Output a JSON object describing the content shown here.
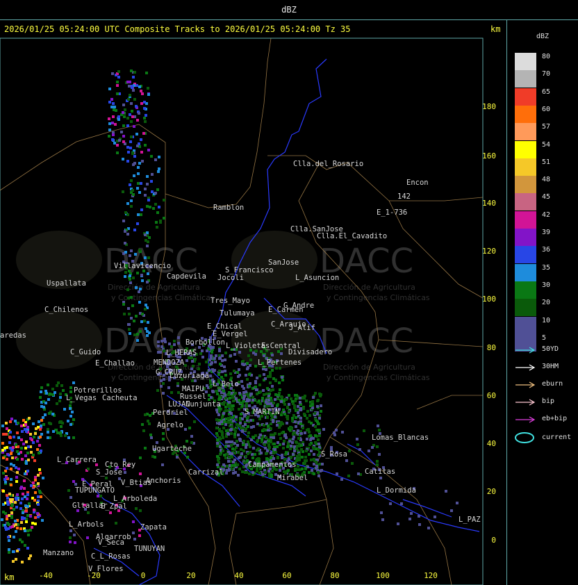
{
  "window": {
    "title": "dBZ"
  },
  "header": {
    "text": "2026/01/25 05:24:00 UTC Composite Tracks to 2026/01/25 05:24:00 Tz 35",
    "km_top": "km",
    "km_bottom": "km"
  },
  "axes": {
    "y_ticks": [
      "180",
      "160",
      "140",
      "120",
      "100",
      "80",
      "60",
      "40",
      "20",
      "0"
    ],
    "x_ticks": [
      "-40",
      "-20",
      "0",
      "20",
      "40",
      "60",
      "80",
      "100",
      "120"
    ]
  },
  "places": [
    "Clla.del_Rosario",
    "Encon",
    "142",
    "E_1-736",
    "Ramblon",
    "Clla.SanJose",
    "Clla.El_Cavadito",
    "Villavicencio",
    "Capdevila",
    "S_Francisco",
    "Jocoli",
    "SanJose",
    "L_Asuncion",
    "Uspallata",
    "Tres_Mayo",
    "Tulumaya",
    "G_Andre",
    "E_Carmen",
    "C_Chilenos",
    "E_Chical",
    "E_Vergel",
    "C_Araujo",
    "J_Alif",
    "aredas",
    "Borbollon",
    "L_Violetas",
    "E_Central",
    "Divisadero",
    "C_Guido",
    "E_Challao",
    "L_HERAS",
    "MENDOZA",
    "L_Pertenes",
    "G_CRUZ",
    "Luzuriaga",
    "L_Belo",
    "Potrerillos",
    "MAIPU",
    "Russel",
    "L_Vegas",
    "Cacheuta",
    "LUJAN",
    "Cunjunta",
    "Perdriel",
    "S_MARTIN",
    "Agrelo",
    "L_Carrera",
    "Ugarteche",
    "Lomas_Blancas",
    "S_Rosa",
    "Catitas",
    "Cto_Rey",
    "S_Jose",
    "E_Peral",
    "TUPUNGATO",
    "V_Btias",
    "Anchoris",
    "Carrizal",
    "Campamentos",
    "Mirabel",
    "L_Dormida",
    "L_Arboleda",
    "Gltallar",
    "E_Zpal",
    "L_Arbols",
    "Algarrob",
    "V_Seca",
    "Zapata",
    "L_PAZ",
    "Manzano",
    "TUNUYAN",
    "C_L_Rosas",
    "V_Flores"
  ],
  "watermark": {
    "brand": "DACC",
    "line1": "Dirección de Agricultura",
    "line2": "y Contingencias Climáticas"
  },
  "legend": {
    "title": "dBZ",
    "scale": [
      {
        "label": "80",
        "color": "#dcdcdc"
      },
      {
        "label": "70",
        "color": "#b4b4b4"
      },
      {
        "label": "65",
        "color": "#f03c28"
      },
      {
        "label": "60",
        "color": "#ff6e0a"
      },
      {
        "label": "57",
        "color": "#ff9a5a"
      },
      {
        "label": "54",
        "color": "#ffff00"
      },
      {
        "label": "51",
        "color": "#f5c828"
      },
      {
        "label": "48",
        "color": "#d2963c"
      },
      {
        "label": "45",
        "color": "#c86482"
      },
      {
        "label": "42",
        "color": "#d21496"
      },
      {
        "label": "39",
        "color": "#8214c8"
      },
      {
        "label": "36",
        "color": "#2846e6"
      },
      {
        "label": "35",
        "color": "#1e8cdc"
      },
      {
        "label": "30",
        "color": "#0a7814"
      },
      {
        "label": "20",
        "color": "#0a5a0a"
      },
      {
        "label": "10",
        "color": "#505096"
      },
      {
        "label": "5",
        "color": "#505096"
      }
    ],
    "tracks": [
      {
        "label": "50YD",
        "color": "#40e0e0"
      },
      {
        "label": "30HM",
        "color": "#ffffff"
      },
      {
        "label": "eburn",
        "color": "#f0c080"
      },
      {
        "label": "bip",
        "color": "#ffc8d2"
      },
      {
        "label": "eb+bip",
        "color": "#e040e0"
      },
      {
        "label": "current",
        "color": "#40e0e0"
      }
    ]
  }
}
